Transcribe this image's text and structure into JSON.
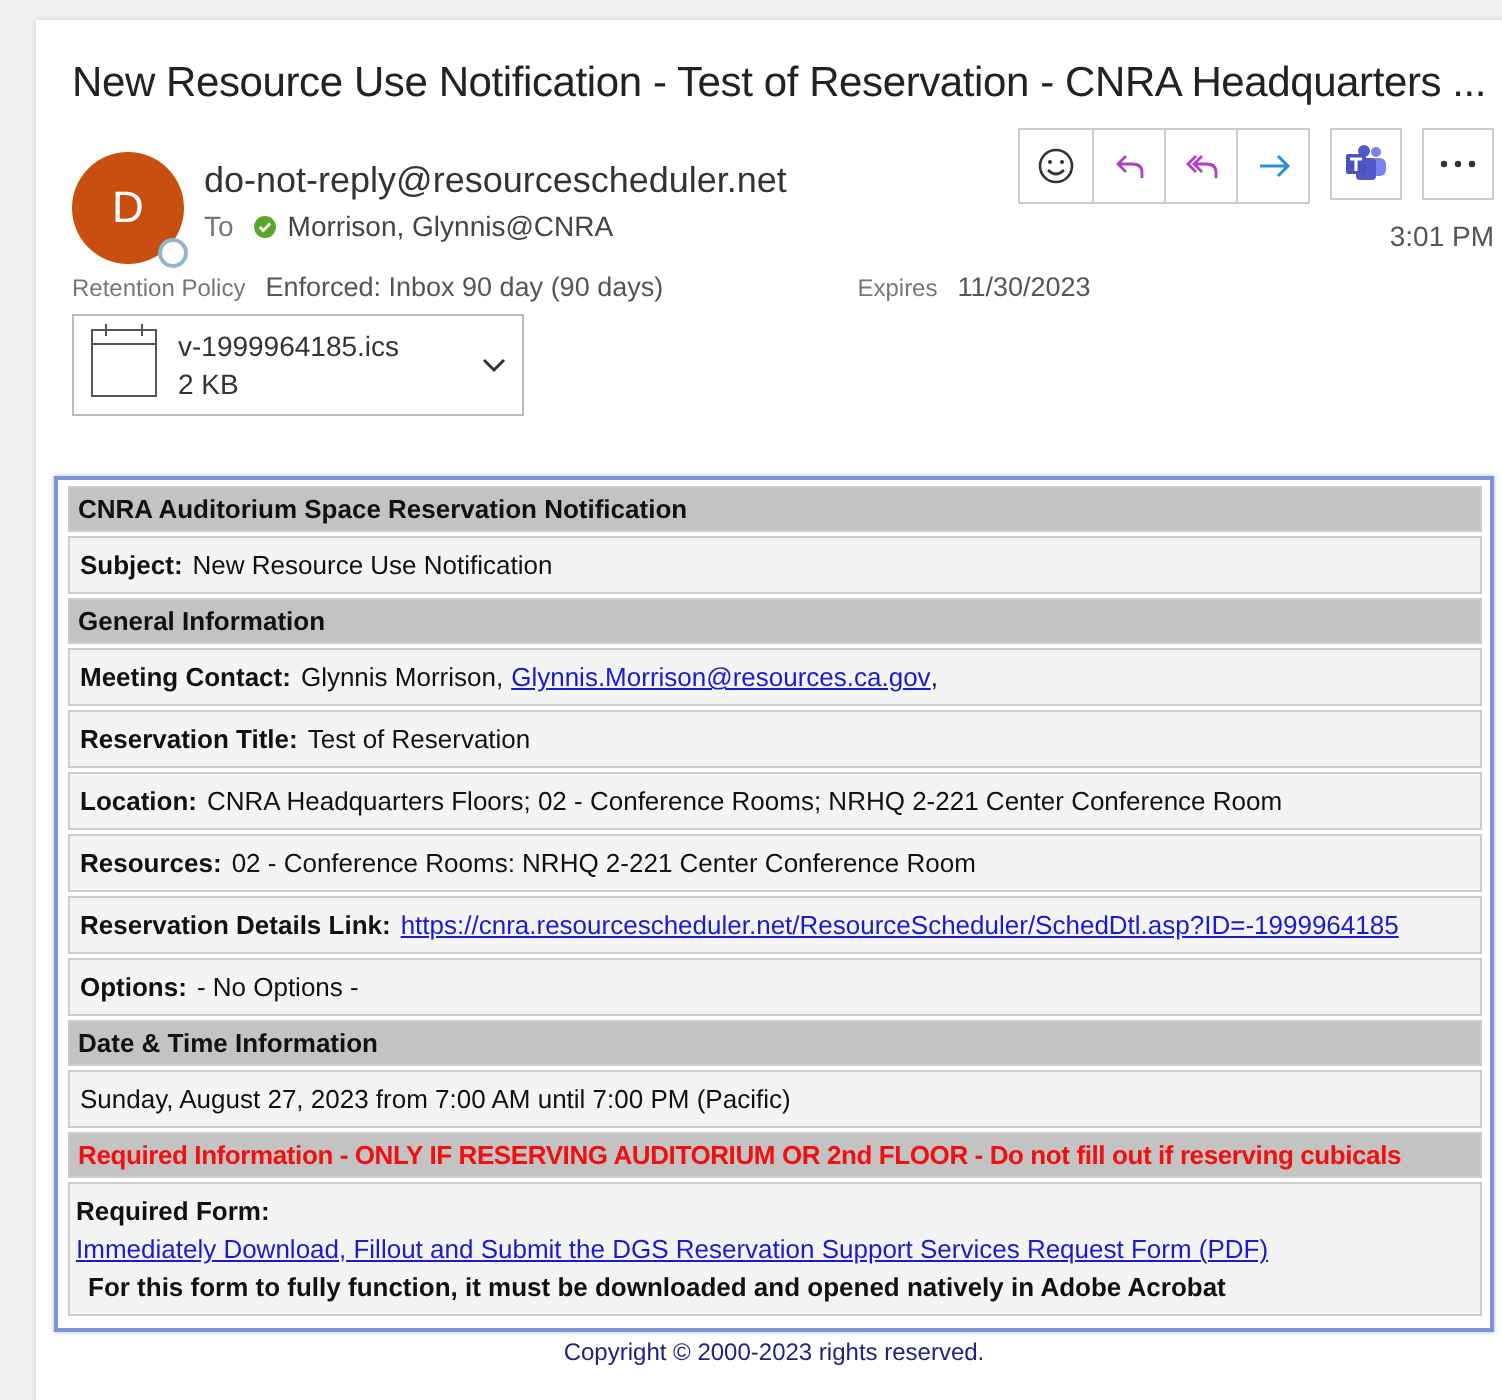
{
  "email": {
    "subject": "New Resource Use Notification - Test of Reservation - CNRA Headquarters ...",
    "avatar_letter": "D",
    "sender": "do-not-reply@resourcescheduler.net",
    "to_label": "To",
    "recipient": "Morrison, Glynnis@CNRA",
    "recipient_online": true,
    "time": "3:01 PM",
    "retention_label": "Retention Policy",
    "retention_value": "Enforced: Inbox 90 day (90 days)",
    "expires_label": "Expires",
    "expires_value": "11/30/2023",
    "attachment": {
      "name": "v-1999964185.ics",
      "size": "2 KB"
    }
  },
  "notification": {
    "rows": [
      {
        "kind": "header",
        "text": "CNRA Auditorium Space Reservation Notification"
      },
      {
        "kind": "field",
        "label": "Subject:",
        "value": "New Resource Use Notification"
      },
      {
        "kind": "header",
        "text": "General Information"
      },
      {
        "kind": "field",
        "label": "Meeting Contact:",
        "value": "Glynnis Morrison,",
        "link": "Glynnis.Morrison@resources.ca.gov",
        "suffix": ","
      },
      {
        "kind": "field",
        "label": "Reservation Title:",
        "value": "Test of Reservation"
      },
      {
        "kind": "field",
        "label": "Location:",
        "value": "CNRA Headquarters Floors; 02 - Conference Rooms; NRHQ 2-221 Center Conference Room"
      },
      {
        "kind": "field",
        "label": "Resources:",
        "value": "02 - Conference Rooms: NRHQ 2-221 Center Conference Room"
      },
      {
        "kind": "field",
        "label": "Reservation Details Link:",
        "link": "https://cnra.resourcescheduler.net/ResourceScheduler/SchedDtl.asp?ID=-1999964185"
      },
      {
        "kind": "field",
        "label": "Options:",
        "value": "- No Options -"
      },
      {
        "kind": "header",
        "text": "Date & Time Information"
      },
      {
        "kind": "text",
        "text": "Sunday, August 27, 2023 from 7:00 AM until 7:00 PM (Pacific)"
      },
      {
        "kind": "warning",
        "text": "Required Information - ONLY IF RESERVING AUDITORIUM OR 2nd FLOOR - Do not fill out if reserving cubicals"
      },
      {
        "kind": "form",
        "label": "Required Form:",
        "link": "Immediately Download, Fillout and Submit the DGS Reservation Support Services Request Form (PDF)",
        "note": "For this form to fully function, it must be downloaded and opened natively in Adobe Acrobat"
      }
    ],
    "copyright": "Copyright © 2000-2023 rights reserved."
  }
}
